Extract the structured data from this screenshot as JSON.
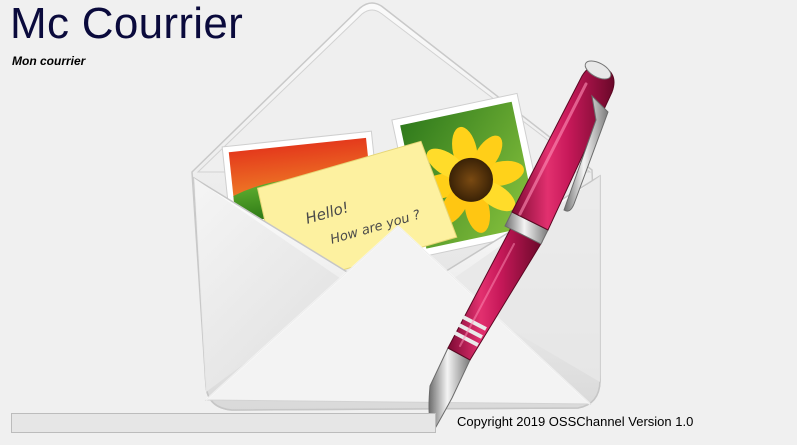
{
  "app": {
    "title": "Mc Courrier",
    "subtitle": "Mon courrier"
  },
  "illustration": {
    "icon": "mail-envelope-pen-icon",
    "note_line_1": "Hello!",
    "note_line_2": "How are you ?"
  },
  "status": {
    "progress": 0,
    "copyright": "Copyright 2019 OSSChannel Version 1.0"
  },
  "colors": {
    "title": "#0a0a3c",
    "background": "#f0f0f0",
    "pen": "#c8195a",
    "note": "#fdf1a0"
  }
}
